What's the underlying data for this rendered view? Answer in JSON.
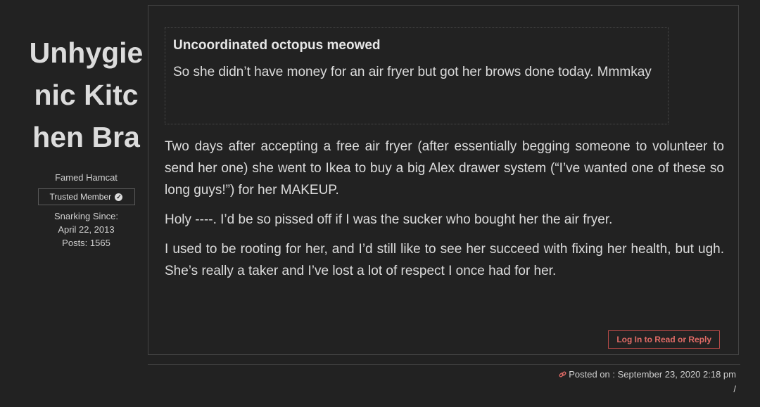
{
  "author": {
    "name": "Unhygienic Kitchen Bra",
    "title": "Famed Hamcat",
    "badge": "Trusted Member",
    "since_label": "Snarking Since:",
    "since_date": "April 22, 2013",
    "posts": "Posts: 1565"
  },
  "quote": {
    "author": "Uncoordinated octopus meowed",
    "text": "So she didn’t have money for an air fryer but got her brows done today. Mmmkay"
  },
  "post": {
    "paragraphs": [
      "Two days after accepting a free air fryer (after essentially begging someone to volunteer to send her one) she went to Ikea to buy a big Alex drawer system (“I’ve wanted one of these so long guys!”) for her MAKEUP.",
      "Holy ----. I’d be so pissed off if I was the sucker who bought her the air fryer.",
      "I used to be rooting for her, and I’d still like to see her succeed with fixing her health, but ugh. She’s really a taker and I’ve lost a lot of respect I once had for her."
    ],
    "login_label": "Log In to Read or Reply"
  },
  "footer": {
    "posted_on": "Posted on : September 23, 2020 2:18 pm",
    "separator": "/"
  },
  "icons": {
    "badge_icon": "check-circle-icon",
    "link_icon": "link-icon"
  },
  "colors": {
    "background": "#222222",
    "accent": "#e06b66"
  }
}
